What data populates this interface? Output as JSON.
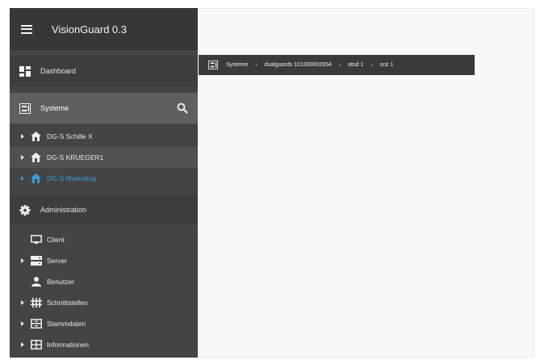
{
  "app": {
    "title": "VisionGuard 0.3"
  },
  "nav": {
    "dashboard_label": "Dashboard",
    "systeme_label": "Systeme",
    "administration_label": "Administration"
  },
  "tree": {
    "items": [
      {
        "label": "DG-S Schille X",
        "state": "normal"
      },
      {
        "label": "DG-S KRUEGER1",
        "state": "hovered"
      },
      {
        "label": "DG-S Marketing",
        "state": "selected-blue"
      }
    ]
  },
  "admin": {
    "items": [
      {
        "label": "Client",
        "icon": "monitor-icon"
      },
      {
        "label": "Server",
        "icon": "server-icon"
      },
      {
        "label": "Benutzer",
        "icon": "user-icon"
      },
      {
        "label": "Schnittstellen",
        "icon": "network-icon"
      },
      {
        "label": "Stammdaten",
        "icon": "database-icon"
      },
      {
        "label": "Informationen",
        "icon": "info-table-icon"
      }
    ]
  },
  "breadcrumb": {
    "items": [
      "Systeme",
      "dualguards 101300002654",
      "atsd 1",
      "scir 1"
    ]
  },
  "colors": {
    "sidebar": "#444444",
    "header": "#373737",
    "active_section": "#5f5f5f",
    "accent_blue": "#3a9ad9",
    "breadcrumb_bg": "#3a3a3a"
  }
}
